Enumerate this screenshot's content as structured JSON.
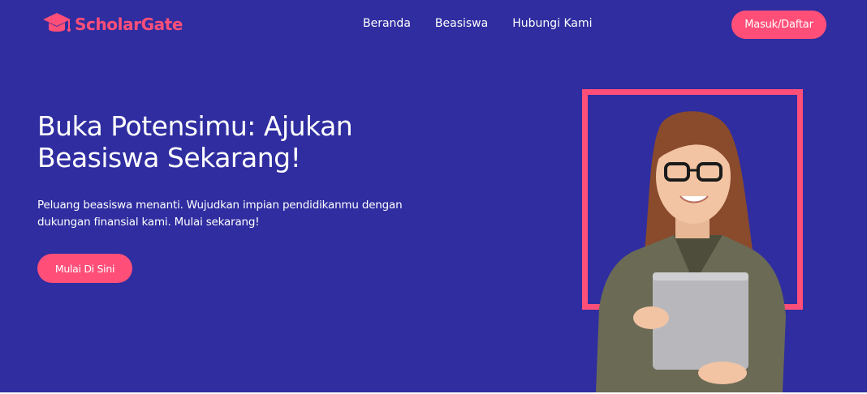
{
  "brand": {
    "name": "ScholarGate",
    "logo_icon": "graduation-cap-icon",
    "color": "#ff4f79"
  },
  "nav": {
    "items": [
      {
        "label": "Beranda"
      },
      {
        "label": "Beasiswa"
      },
      {
        "label": "Hubungi Kami"
      }
    ]
  },
  "header": {
    "login_label": "Masuk/Daftar"
  },
  "hero": {
    "title_line1": "Buka Potensimu: Ajukan",
    "title_line2": "Beasiswa Sekarang!",
    "description_line1": "Peluang beasiswa menanti. Wujudkan impian pendidikanmu dengan",
    "description_line2": "dukungan finansial kami. Mulai sekarang!",
    "cta_label": "Mulai Di Sini"
  },
  "colors": {
    "background": "#2f2da0",
    "accent": "#ff4f79",
    "text": "#ffffff"
  }
}
